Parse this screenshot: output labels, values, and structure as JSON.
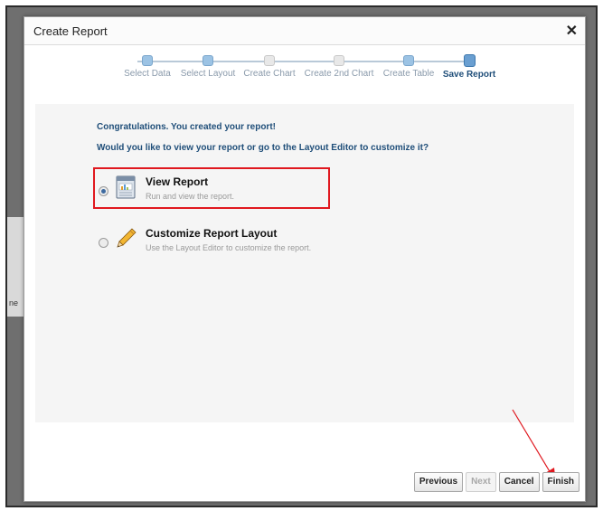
{
  "dialog": {
    "title": "Create Report"
  },
  "train": {
    "steps": [
      {
        "label": "Select Data",
        "state": "visited"
      },
      {
        "label": "Select Layout",
        "state": "visited"
      },
      {
        "label": "Create Chart",
        "state": "inactive"
      },
      {
        "label": "Create 2nd Chart",
        "state": "inactive"
      },
      {
        "label": "Create Table",
        "state": "visited"
      },
      {
        "label": "Save Report",
        "state": "current"
      }
    ]
  },
  "content": {
    "congrats": "Congratulations. You created your report!",
    "question": "Would you like to view your report or go to the Layout Editor to customize it?",
    "options": [
      {
        "title": "View Report",
        "description": "Run and view the report.",
        "selected": true,
        "icon": "report-icon"
      },
      {
        "title": "Customize Report Layout",
        "description": "Use the Layout Editor to customize the report.",
        "selected": false,
        "icon": "pencil-icon"
      }
    ]
  },
  "buttons": {
    "previous": "Previous",
    "next": "Next",
    "cancel": "Cancel",
    "finish": "Finish"
  },
  "background": {
    "partial_text": "ne"
  },
  "colors": {
    "highlight": "#e0181f",
    "annotation_arrow": "#e0181f",
    "message_text": "#1f4e79"
  }
}
